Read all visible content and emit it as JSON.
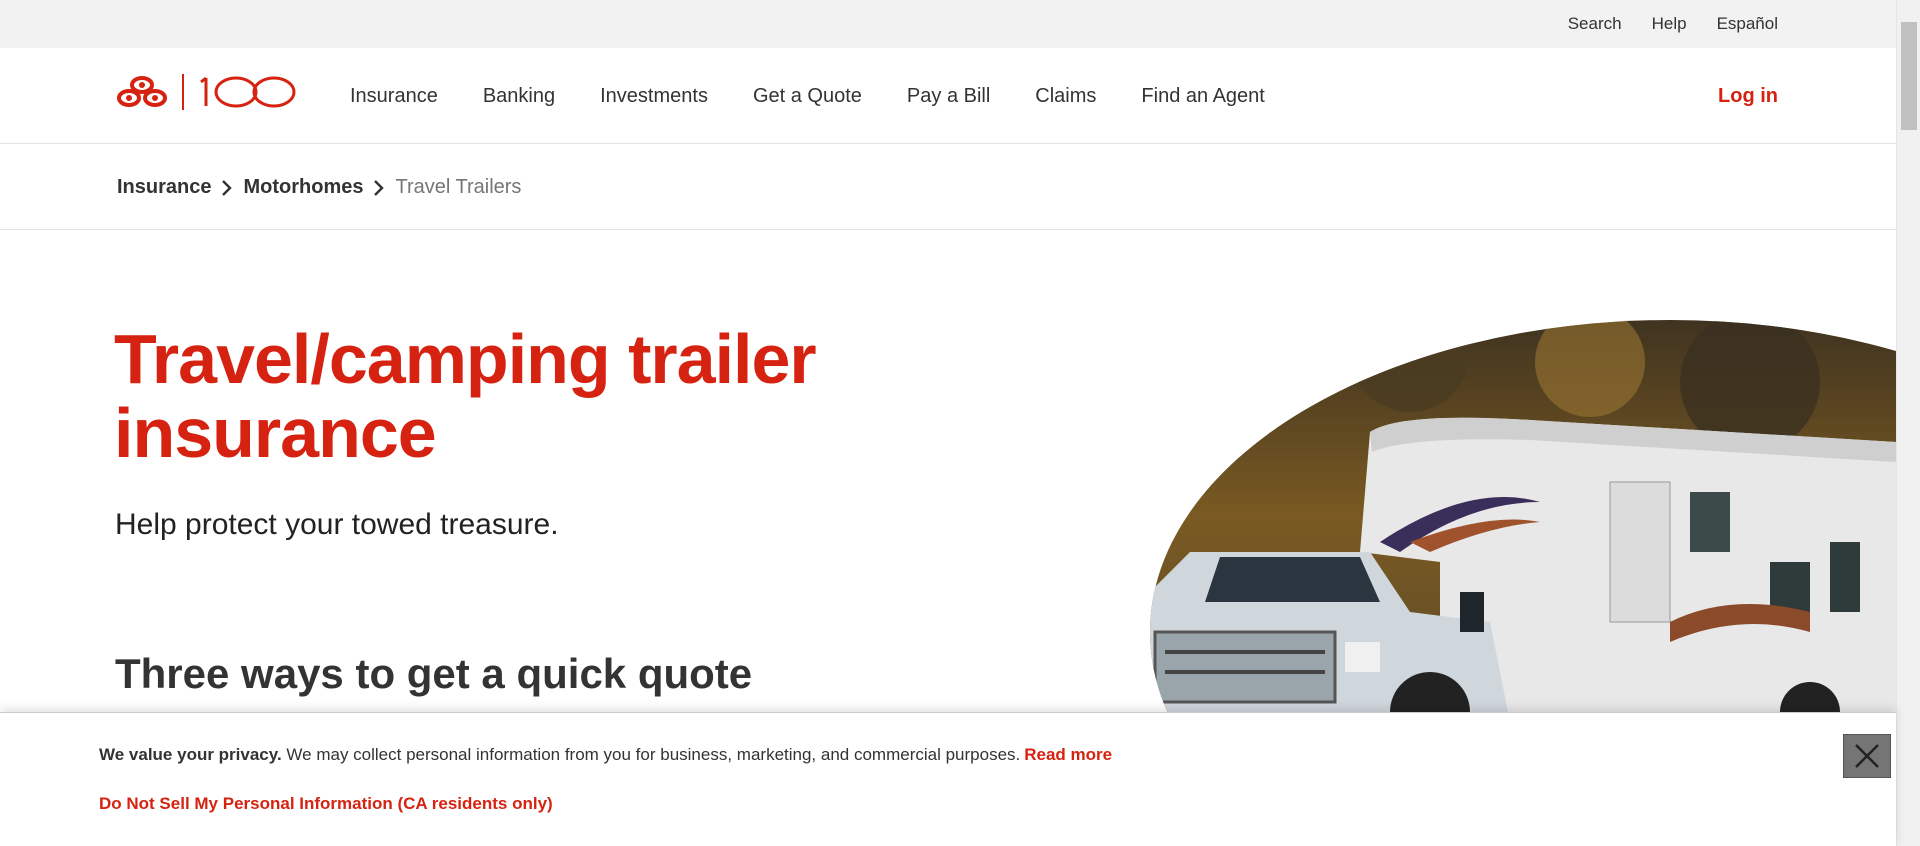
{
  "utility": {
    "search": "Search",
    "help": "Help",
    "espanol": "Español"
  },
  "logo": {
    "brand_mark": "100",
    "icon": "three-ovals-logo-icon"
  },
  "nav": {
    "items": [
      "Insurance",
      "Banking",
      "Investments",
      "Get a Quote",
      "Pay a Bill",
      "Claims",
      "Find an Agent"
    ],
    "login": "Log in"
  },
  "breadcrumb": {
    "items": [
      "Insurance",
      "Motorhomes"
    ],
    "current": "Travel Trailers",
    "separator_icon": "chevron-right-icon"
  },
  "hero": {
    "title_line1": "Travel/camping trailer",
    "title_line2": "insurance",
    "subtitle": "Help protect your towed treasure.",
    "section_title": "Three ways to get a quick quote"
  },
  "privacy": {
    "lead": "We value your privacy.",
    "text": " We may collect personal information from you for business, marketing, and commercial purposes.",
    "read_more": "Read more",
    "do_not_sell": "Do Not Sell My Personal Information (CA residents only)",
    "close_icon": "close-icon"
  },
  "colors": {
    "brand_red": "#d62311",
    "utility_bg": "#f2f2f2",
    "close_bg": "#757575"
  }
}
